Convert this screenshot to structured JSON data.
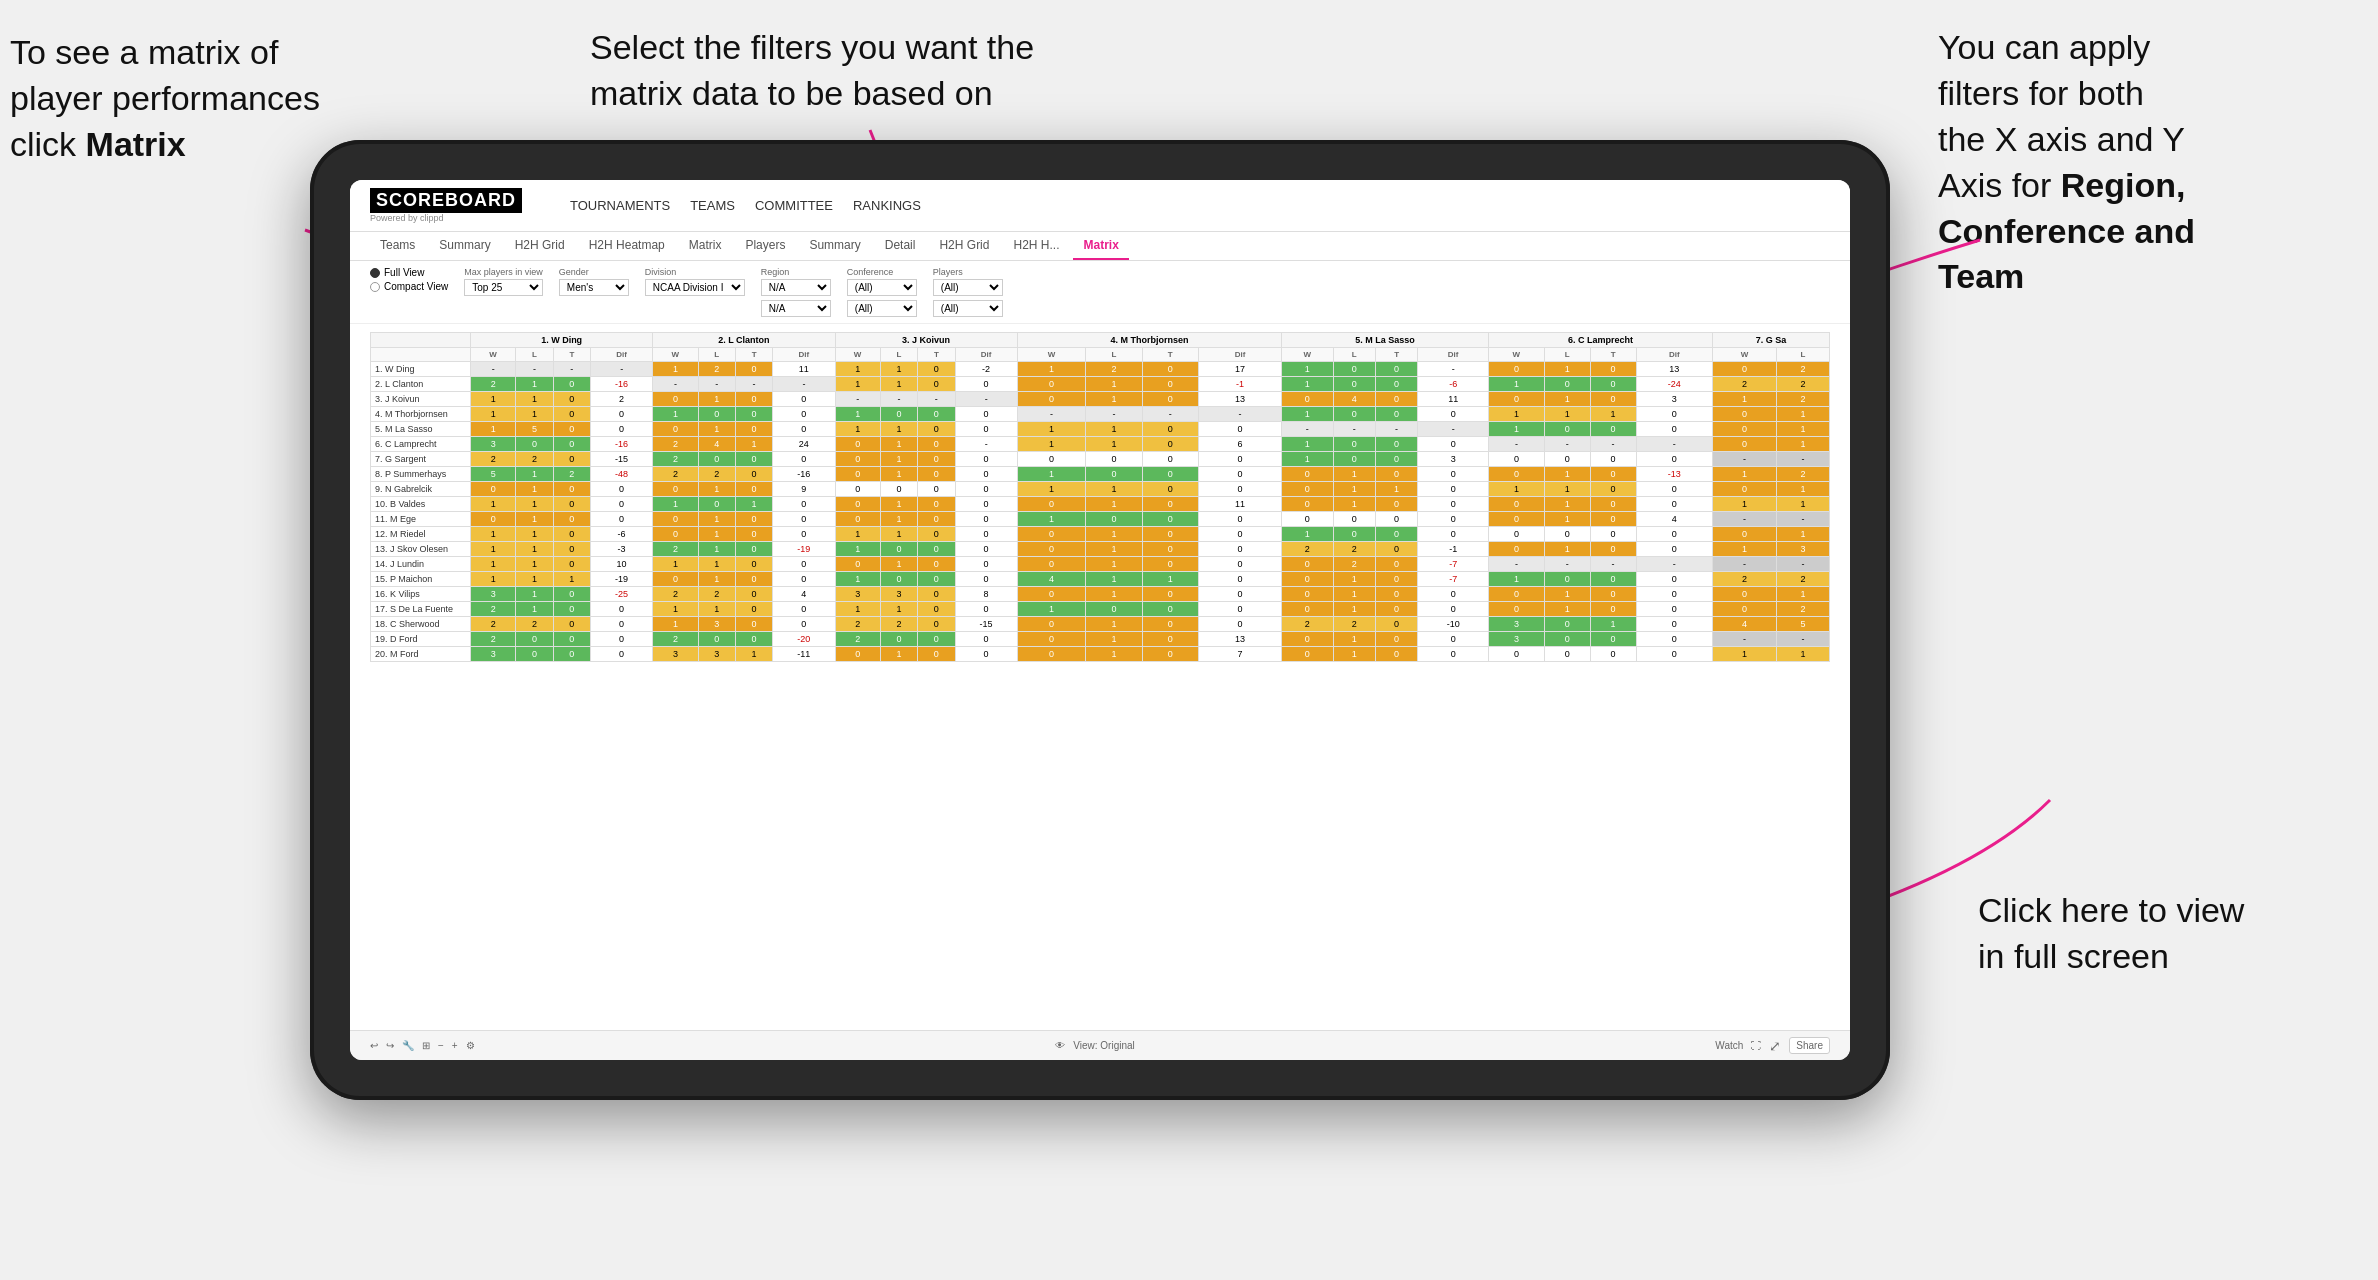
{
  "annotations": {
    "top_left": {
      "line1": "To see a matrix of",
      "line2": "player performances",
      "line3_normal": "click ",
      "line3_bold": "Matrix"
    },
    "top_center": {
      "text": "Select the filters you want the matrix data to be based on"
    },
    "top_right": {
      "line1": "You  can apply",
      "line2": "filters for both",
      "line3": "the X axis and Y",
      "line4_normal": "Axis for ",
      "line4_bold": "Region,",
      "line5_bold": "Conference and",
      "line6_bold": "Team"
    },
    "bottom_right": {
      "line1": "Click here to view",
      "line2": "in full screen"
    }
  },
  "app": {
    "logo": "SCOREBOARD",
    "logo_sub": "Powered by clippd",
    "nav": [
      "TOURNAMENTS",
      "TEAMS",
      "COMMITTEE",
      "RANKINGS"
    ],
    "tabs": [
      "Teams",
      "Summary",
      "H2H Grid",
      "H2H Heatmap",
      "Matrix",
      "Players",
      "Summary",
      "Detail",
      "H2H Grid",
      "H2H H...",
      "Matrix"
    ],
    "active_tab": "Matrix",
    "filters": {
      "view_options": [
        "Full View",
        "Compact View"
      ],
      "active_view": "Full View",
      "max_players_label": "Max players in view",
      "max_players_value": "Top 25",
      "gender_label": "Gender",
      "gender_value": "Men's",
      "division_label": "Division",
      "division_value": "NCAA Division I",
      "region_label": "Region",
      "region_values": [
        "N/A",
        "N/A"
      ],
      "conference_label": "Conference",
      "conference_values": [
        "(All)",
        "(All)"
      ],
      "players_label": "Players",
      "players_values": [
        "(All)",
        "(All)"
      ]
    },
    "column_headers": [
      "1. W Ding",
      "2. L Clanton",
      "3. J Koivun",
      "4. M Thorbjornsen",
      "5. M La Sasso",
      "6. C Lamprecht",
      "7. G Sa"
    ],
    "sub_headers": [
      "W",
      "L",
      "T",
      "Dif"
    ],
    "rows": [
      {
        "name": "1. W Ding",
        "cells": [
          [
            "-",
            "-",
            "-",
            "-"
          ],
          [
            "1",
            "2",
            "0",
            "11"
          ],
          [
            "1",
            "1",
            "0",
            "-2"
          ],
          [
            "1",
            "2",
            "0",
            "17"
          ],
          [
            "1",
            "0",
            "0",
            "-"
          ],
          [
            "0",
            "1",
            "0",
            "13"
          ],
          [
            "0",
            "2"
          ]
        ]
      },
      {
        "name": "2. L Clanton",
        "cells": [
          [
            "2",
            "1",
            "0",
            "-16"
          ],
          [
            "-",
            "-",
            "-",
            "-"
          ],
          [
            "1",
            "1",
            "0",
            "0"
          ],
          [
            "0",
            "1",
            "0",
            "-1"
          ],
          [
            "1",
            "0",
            "0",
            "-6"
          ],
          [
            "1",
            "0",
            "0",
            "-24"
          ],
          [
            "2",
            "2"
          ]
        ]
      },
      {
        "name": "3. J Koivun",
        "cells": [
          [
            "1",
            "1",
            "0",
            "2"
          ],
          [
            "0",
            "1",
            "0",
            "0"
          ],
          [
            "-",
            "-",
            "-",
            "-"
          ],
          [
            "0",
            "1",
            "0",
            "13"
          ],
          [
            "0",
            "4",
            "0",
            "11"
          ],
          [
            "0",
            "1",
            "0",
            "3"
          ],
          [
            "1",
            "2"
          ]
        ]
      },
      {
        "name": "4. M Thorbjornsen",
        "cells": [
          [
            "1",
            "1",
            "0",
            "0"
          ],
          [
            "1",
            "0",
            "0",
            "0"
          ],
          [
            "1",
            "0",
            "0",
            "0"
          ],
          [
            "-",
            "-",
            "-",
            "-"
          ],
          [
            "1",
            "0",
            "0",
            "0"
          ],
          [
            "1",
            "1",
            "1",
            "0"
          ],
          [
            "0",
            "1"
          ]
        ]
      },
      {
        "name": "5. M La Sasso",
        "cells": [
          [
            "1",
            "5",
            "0",
            "0"
          ],
          [
            "0",
            "1",
            "0",
            "0"
          ],
          [
            "1",
            "1",
            "0",
            "0"
          ],
          [
            "1",
            "1",
            "0",
            "0"
          ],
          [
            "-",
            "-",
            "-",
            "-"
          ],
          [
            "1",
            "0",
            "0",
            "0"
          ],
          [
            "0",
            "1"
          ]
        ]
      },
      {
        "name": "6. C Lamprecht",
        "cells": [
          [
            "3",
            "0",
            "0",
            "-16"
          ],
          [
            "2",
            "4",
            "1",
            "24"
          ],
          [
            "0",
            "1",
            "0",
            "-"
          ],
          [
            "1",
            "1",
            "0",
            "6"
          ],
          [
            "1",
            "0",
            "0",
            "0"
          ],
          [
            "-",
            "-",
            "-",
            "-"
          ],
          [
            "0",
            "1"
          ]
        ]
      },
      {
        "name": "7. G Sargent",
        "cells": [
          [
            "2",
            "2",
            "0",
            "-15"
          ],
          [
            "2",
            "0",
            "0",
            "0"
          ],
          [
            "0",
            "1",
            "0",
            "0"
          ],
          [
            "0",
            "0",
            "0",
            "0"
          ],
          [
            "1",
            "0",
            "0",
            "3"
          ],
          [
            "0",
            "0",
            "0",
            "0"
          ],
          [
            "-",
            "-"
          ]
        ]
      },
      {
        "name": "8. P Summerhays",
        "cells": [
          [
            "5",
            "1",
            "2",
            "-48"
          ],
          [
            "2",
            "2",
            "0",
            "-16"
          ],
          [
            "0",
            "1",
            "0",
            "0"
          ],
          [
            "1",
            "0",
            "0",
            "0"
          ],
          [
            "0",
            "1",
            "0",
            "0"
          ],
          [
            "0",
            "1",
            "0",
            "-13"
          ],
          [
            "1",
            "2"
          ]
        ]
      },
      {
        "name": "9. N Gabrelcik",
        "cells": [
          [
            "0",
            "1",
            "0",
            "0"
          ],
          [
            "0",
            "1",
            "0",
            "9"
          ],
          [
            "0",
            "0",
            "0",
            "0"
          ],
          [
            "1",
            "1",
            "0",
            "0"
          ],
          [
            "0",
            "1",
            "1",
            "0"
          ],
          [
            "1",
            "1",
            "0",
            "0"
          ],
          [
            "0",
            "1"
          ]
        ]
      },
      {
        "name": "10. B Valdes",
        "cells": [
          [
            "1",
            "1",
            "0",
            "0"
          ],
          [
            "1",
            "0",
            "1",
            "0"
          ],
          [
            "0",
            "1",
            "0",
            "0"
          ],
          [
            "0",
            "1",
            "0",
            "11"
          ],
          [
            "0",
            "1",
            "0",
            "0"
          ],
          [
            "0",
            "1",
            "0",
            "0"
          ],
          [
            "1",
            "1"
          ]
        ]
      },
      {
        "name": "11. M Ege",
        "cells": [
          [
            "0",
            "1",
            "0",
            "0"
          ],
          [
            "0",
            "1",
            "0",
            "0"
          ],
          [
            "0",
            "1",
            "0",
            "0"
          ],
          [
            "1",
            "0",
            "0",
            "0"
          ],
          [
            "0",
            "0",
            "0",
            "0"
          ],
          [
            "0",
            "1",
            "0",
            "4"
          ],
          [
            "-",
            "-"
          ]
        ]
      },
      {
        "name": "12. M Riedel",
        "cells": [
          [
            "1",
            "1",
            "0",
            "-6"
          ],
          [
            "0",
            "1",
            "0",
            "0"
          ],
          [
            "1",
            "1",
            "0",
            "0"
          ],
          [
            "0",
            "1",
            "0",
            "0"
          ],
          [
            "1",
            "0",
            "0",
            "0"
          ],
          [
            "0",
            "0",
            "0",
            "0"
          ],
          [
            "0",
            "1"
          ]
        ]
      },
      {
        "name": "13. J Skov Olesen",
        "cells": [
          [
            "1",
            "1",
            "0",
            "-3"
          ],
          [
            "2",
            "1",
            "0",
            "-19"
          ],
          [
            "1",
            "0",
            "0",
            "0"
          ],
          [
            "0",
            "1",
            "0",
            "0"
          ],
          [
            "2",
            "2",
            "0",
            "-1"
          ],
          [
            "0",
            "1",
            "0",
            "0"
          ],
          [
            "1",
            "3"
          ]
        ]
      },
      {
        "name": "14. J Lundin",
        "cells": [
          [
            "1",
            "1",
            "0",
            "10"
          ],
          [
            "1",
            "1",
            "0",
            "0"
          ],
          [
            "0",
            "1",
            "0",
            "0"
          ],
          [
            "0",
            "1",
            "0",
            "0"
          ],
          [
            "0",
            "2",
            "0",
            "-7"
          ],
          [
            "-",
            "-",
            "-",
            "-"
          ],
          [
            "-",
            "-"
          ]
        ]
      },
      {
        "name": "15. P Maichon",
        "cells": [
          [
            "1",
            "1",
            "1",
            "-19"
          ],
          [
            "0",
            "1",
            "0",
            "0"
          ],
          [
            "1",
            "0",
            "0",
            "0"
          ],
          [
            "4",
            "1",
            "1",
            "0"
          ],
          [
            "0",
            "1",
            "0",
            "-7"
          ],
          [
            "1",
            "0",
            "0",
            "0"
          ],
          [
            "2",
            "2"
          ]
        ]
      },
      {
        "name": "16. K Vilips",
        "cells": [
          [
            "3",
            "1",
            "0",
            "-25"
          ],
          [
            "2",
            "2",
            "0",
            "4"
          ],
          [
            "3",
            "3",
            "0",
            "8"
          ],
          [
            "0",
            "1",
            "0",
            "0"
          ],
          [
            "0",
            "1",
            "0",
            "0"
          ],
          [
            "0",
            "1",
            "0",
            "0"
          ],
          [
            "0",
            "1"
          ]
        ]
      },
      {
        "name": "17. S De La Fuente",
        "cells": [
          [
            "2",
            "1",
            "0",
            "0"
          ],
          [
            "1",
            "1",
            "0",
            "0"
          ],
          [
            "1",
            "1",
            "0",
            "0"
          ],
          [
            "1",
            "0",
            "0",
            "0"
          ],
          [
            "0",
            "1",
            "0",
            "0"
          ],
          [
            "0",
            "1",
            "0",
            "0"
          ],
          [
            "0",
            "2"
          ]
        ]
      },
      {
        "name": "18. C Sherwood",
        "cells": [
          [
            "2",
            "2",
            "0",
            "0"
          ],
          [
            "1",
            "3",
            "0",
            "0"
          ],
          [
            "2",
            "2",
            "0",
            "-15"
          ],
          [
            "0",
            "1",
            "0",
            "0"
          ],
          [
            "2",
            "2",
            "0",
            "-10"
          ],
          [
            "3",
            "0",
            "1",
            "0"
          ],
          [
            "4",
            "5"
          ]
        ]
      },
      {
        "name": "19. D Ford",
        "cells": [
          [
            "2",
            "0",
            "0",
            "0"
          ],
          [
            "2",
            "0",
            "0",
            "-20"
          ],
          [
            "2",
            "0",
            "0",
            "0"
          ],
          [
            "0",
            "1",
            "0",
            "13"
          ],
          [
            "0",
            "1",
            "0",
            "0"
          ],
          [
            "3",
            "0",
            "0",
            "0"
          ],
          [
            "-",
            "-"
          ]
        ]
      },
      {
        "name": "20. M Ford",
        "cells": [
          [
            "3",
            "0",
            "0",
            "0"
          ],
          [
            "3",
            "3",
            "1",
            "-11"
          ],
          [
            "0",
            "1",
            "0",
            "0"
          ],
          [
            "0",
            "1",
            "0",
            "7"
          ],
          [
            "0",
            "1",
            "0",
            "0"
          ],
          [
            "0",
            "0",
            "0",
            "0"
          ],
          [
            "1",
            "1"
          ]
        ]
      }
    ]
  },
  "toolbar": {
    "view_label": "View: Original",
    "watch_label": "Watch",
    "share_label": "Share"
  }
}
